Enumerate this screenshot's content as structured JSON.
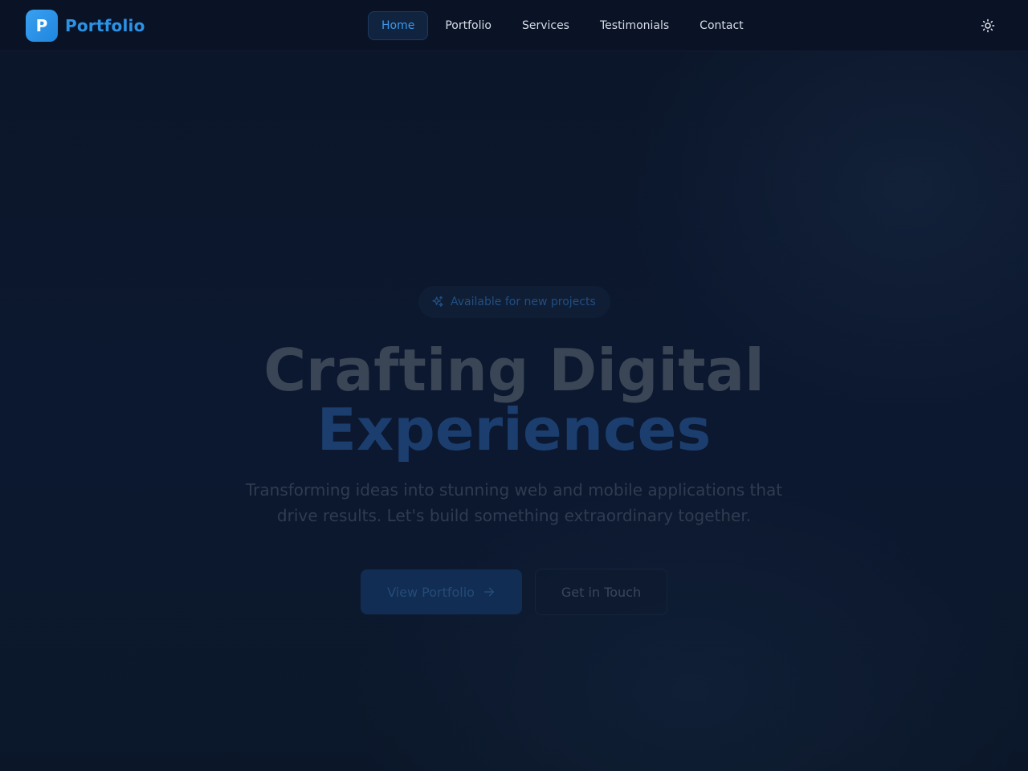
{
  "header": {
    "logo_letter": "P",
    "brand": "Portfolio",
    "nav": [
      {
        "label": "Home",
        "active": true
      },
      {
        "label": "Portfolio",
        "active": false
      },
      {
        "label": "Services",
        "active": false
      },
      {
        "label": "Testimonials",
        "active": false
      },
      {
        "label": "Contact",
        "active": false
      }
    ],
    "theme_toggle_icon": "sun-icon"
  },
  "hero": {
    "badge_icon": "sparkles-icon",
    "badge_text": "Available for new projects",
    "headline_line1": "Crafting Digital",
    "headline_line2": "Experiences",
    "subtitle_line1": "Transforming ideas into stunning web and mobile applications that",
    "subtitle_line2": "drive results. Let's build something extraordinary together.",
    "primary_button": "View Portfolio",
    "primary_button_icon": "arrow-right-icon",
    "secondary_button": "Get in Touch"
  },
  "colors": {
    "accent": "#2b93e6",
    "background": "#0b1629",
    "header_bg": "#0a1326"
  }
}
